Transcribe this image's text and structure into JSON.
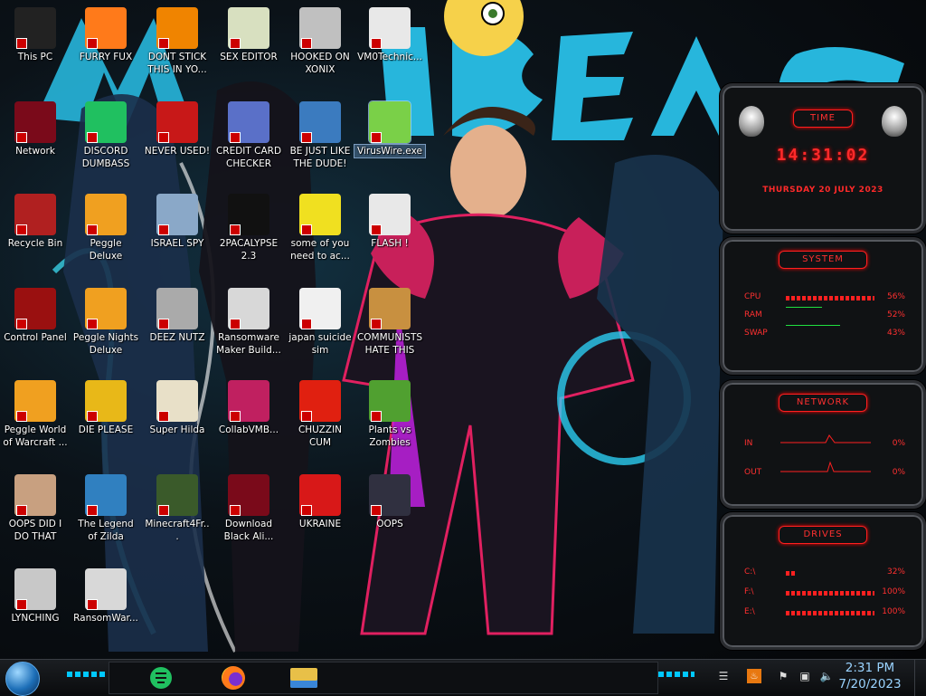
{
  "desktop": {
    "icons": [
      {
        "label": "This PC",
        "icon": "computer-icon",
        "color": "#222"
      },
      {
        "label": "FURRY FUX",
        "icon": "firefox-icon",
        "color": "#ff7a1a"
      },
      {
        "label": "DONT STICK THIS IN YO...",
        "icon": "vlc-cone-icon",
        "color": "#f08400"
      },
      {
        "label": "SEX EDITOR",
        "icon": "hxd-editor-icon",
        "color": "#d8e0c0"
      },
      {
        "label": "HOOKED ON XONIX",
        "icon": "game-icon",
        "color": "#c0c0c0"
      },
      {
        "label": "VM0Technic...",
        "icon": "technician-icon",
        "color": "#e8e8e8"
      },
      {
        "label": "Network",
        "icon": "network-orb-icon",
        "color": "#7a0a1a"
      },
      {
        "label": "DISCORD DUMBASS",
        "icon": "chat-icon",
        "color": "#20c060"
      },
      {
        "label": "NEVER USED!",
        "icon": "dev-cpp-icon",
        "color": "#c81818"
      },
      {
        "label": "CREDIT CARD CHECKER",
        "icon": "credit-card-icon",
        "color": "#5a70c8"
      },
      {
        "label": "BE JUST LIKE THE DUDE!",
        "icon": "santa-icon",
        "color": "#3b7bbf"
      },
      {
        "label": "VirusWire.exe",
        "icon": "limewire-icon",
        "color": "#7ad048"
      },
      {
        "label": "Recycle Bin",
        "icon": "recycle-bin-icon",
        "color": "#b02020"
      },
      {
        "label": "Peggle Deluxe",
        "icon": "peggle-icon",
        "color": "#f0a020"
      },
      {
        "label": "ISRAEL SPY",
        "icon": "spy-computer-icon",
        "color": "#8aa8c8"
      },
      {
        "label": "2PACALYPSE 2.3",
        "icon": "terminal-icon",
        "color": "#111"
      },
      {
        "label": "some of you need to ac...",
        "icon": "beaver-icon",
        "color": "#f0e020"
      },
      {
        "label": "FLASH !",
        "icon": "flash-file-icon",
        "color": "#e8e8e8"
      },
      {
        "label": "Control Panel",
        "icon": "control-panel-icon",
        "color": "#9a1010"
      },
      {
        "label": "Peggle Nights Deluxe",
        "icon": "peggle-icon",
        "color": "#f0a020"
      },
      {
        "label": "DEEZ NUTZ",
        "icon": "windows-stack-icon",
        "color": "#aaaaaa"
      },
      {
        "label": "Ransomware Maker Build...",
        "icon": "application-icon",
        "color": "#d8d8d8"
      },
      {
        "label": "japan suicide sim",
        "icon": "document-icon",
        "color": "#f0f0f0"
      },
      {
        "label": "COMMUNISTS HATE THIS G...",
        "icon": "money-bag-icon",
        "color": "#c89040"
      },
      {
        "label": "Peggle World of Warcraft ...",
        "icon": "peggle-icon",
        "color": "#f0a020"
      },
      {
        "label": "DIE PLEASE",
        "icon": "de-icon",
        "color": "#e8b818"
      },
      {
        "label": "Super Hilda",
        "icon": "pixel-game-icon",
        "color": "#e8e0c8"
      },
      {
        "label": "CollabVMB...",
        "icon": "collabvm-icon",
        "color": "#c02060"
      },
      {
        "label": "CHUZZIN CUM",
        "icon": "chuzzle-icon",
        "color": "#e02010"
      },
      {
        "label": "Plants vs Zombies",
        "icon": "plant-icon",
        "color": "#50a030"
      },
      {
        "label": "OOPS DID I DO THAT",
        "icon": "portrait-icon",
        "color": "#c8a080"
      },
      {
        "label": "The Legend of Zilda",
        "icon": "zelda-sprite-icon",
        "color": "#3080c0"
      },
      {
        "label": "Minecraft4Fr...",
        "icon": "minecraft-block-icon",
        "color": "#3a5a2a"
      },
      {
        "label": "Download Black Ali...",
        "icon": "alien-orb-icon",
        "color": "#7a0a1a"
      },
      {
        "label": "UKRAINE",
        "icon": "radiation-icon",
        "color": "#d81818"
      },
      {
        "label": "OOPS",
        "icon": "monitor-icon",
        "color": "#303040"
      },
      {
        "label": "LYNCHING",
        "icon": "gear-flag-icon",
        "color": "#c8c8c8"
      },
      {
        "label": "RansomWar...",
        "icon": "skull-icon",
        "color": "#d8d8d8"
      }
    ],
    "selected_index": 11
  },
  "gadgets": {
    "time": {
      "title": "TIME",
      "clock": "14:31:02",
      "date": "THURSDAY 20 JULY 2023"
    },
    "system": {
      "title": "SYSTEM",
      "rows": [
        {
          "key": "CPU",
          "value": "56%"
        },
        {
          "key": "RAM",
          "value": "52%"
        },
        {
          "key": "SWAP",
          "value": "43%"
        }
      ]
    },
    "network": {
      "title": "NETWORK",
      "rows": [
        {
          "key": "IN",
          "value": "0%"
        },
        {
          "key": "OUT",
          "value": "0%"
        }
      ]
    },
    "drives": {
      "title": "DRIVES",
      "rows": [
        {
          "key": "C:\\",
          "value": "32%"
        },
        {
          "key": "F:\\",
          "value": "100%"
        },
        {
          "key": "E:\\",
          "value": "100%"
        }
      ]
    }
  },
  "taskbar": {
    "pinned": [
      {
        "name": "chat-app",
        "icon": "chat-icon",
        "color": "#20c060"
      },
      {
        "name": "firefox",
        "icon": "firefox-icon",
        "color": "#ff7a1a"
      },
      {
        "name": "file-explorer",
        "icon": "folder-icon",
        "color": "#e8c048"
      }
    ],
    "clock_time": "2:31 PM",
    "clock_date": "7/20/2023"
  },
  "colors": {
    "accent_red": "#ff2020",
    "accent_cyan": "#00c8ff"
  }
}
